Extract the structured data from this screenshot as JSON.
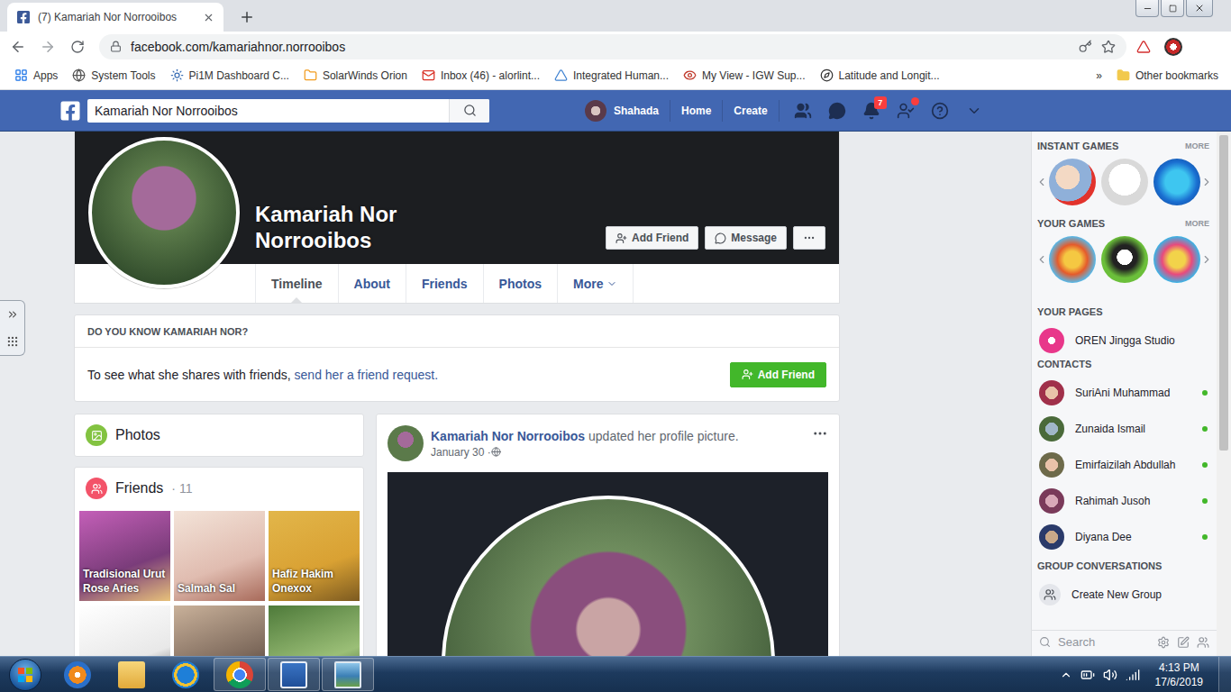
{
  "browser": {
    "tabs": [
      {
        "label": "(7) Kamariah Nor Norrooibos",
        "selected": true
      }
    ],
    "address": "facebook.com/kamariahnor.norrooibos",
    "bookmarks": [
      {
        "label": "Apps",
        "kind": "apps"
      },
      {
        "label": "System Tools",
        "kind": "globe"
      },
      {
        "label": "Pi1M Dashboard C...",
        "kind": "pi"
      },
      {
        "label": "SolarWinds Orion",
        "kind": "solar"
      },
      {
        "label": "Inbox (46) - alorlint...",
        "kind": "gmail"
      },
      {
        "label": "Integrated Human...",
        "kind": "tri"
      },
      {
        "label": "My View - IGW Sup...",
        "kind": "view"
      },
      {
        "label": "Latitude and Longit...",
        "kind": "compass"
      }
    ],
    "overflow": "»",
    "other_bookmarks": "Other bookmarks"
  },
  "header": {
    "search": "Kamariah Nor Norrooibos",
    "user": "Shahada",
    "links": [
      "Home",
      "Create"
    ],
    "notifications": "7",
    "quick_help_alert": true
  },
  "profile": {
    "name": "Kamariah Nor Norrooibos",
    "actions": [
      "Add Friend",
      "Message"
    ],
    "nav": [
      {
        "label": "Timeline",
        "selected": true,
        "dropdown": false
      },
      {
        "label": "About",
        "selected": false,
        "dropdown": false
      },
      {
        "label": "Friends",
        "selected": false,
        "dropdown": false
      },
      {
        "label": "Photos",
        "selected": false,
        "dropdown": false
      },
      {
        "label": "More",
        "selected": false,
        "dropdown": true
      }
    ]
  },
  "know": {
    "title": "DO YOU KNOW KAMARIAH NOR?",
    "text": "To see what she shares with friends, ",
    "link": "send her a friend request.",
    "button": "Add Friend"
  },
  "photos": {
    "title": "Photos"
  },
  "friends": {
    "title": "Friends",
    "count": "· 11",
    "items": [
      {
        "kind": "named",
        "name": "Tradisional Urut Rose Aries"
      },
      {
        "kind": "named",
        "name": "Salmah Sal"
      },
      {
        "kind": "named",
        "name": "Hafiz Hakim Onexox"
      },
      {
        "kind": "cut"
      },
      {
        "kind": "cut"
      },
      {
        "kind": "cut"
      }
    ]
  },
  "post": {
    "author": "Kamariah Nor Norrooibos",
    "action": "updated her profile picture.",
    "date": "January 30 · "
  },
  "sidebar": {
    "instant_games": {
      "title": "INSTANT GAMES",
      "more": "MORE",
      "items": [
        {
          "kind": "uno"
        },
        {
          "kind": "sketch"
        },
        {
          "kind": "tetris"
        }
      ]
    },
    "your_games": {
      "title": "YOUR GAMES",
      "more": "MORE",
      "items": [
        {
          "kind": "fruit"
        },
        {
          "kind": "panda"
        },
        {
          "kind": "candy"
        }
      ]
    },
    "pages": {
      "title": "YOUR PAGES",
      "items": [
        "OREN Jingga Studio"
      ]
    },
    "contacts": {
      "title": "CONTACTS",
      "items": [
        {
          "name": "SuriAni Muhammad",
          "online": true
        },
        {
          "name": "Zunaida Ismail",
          "online": true
        },
        {
          "name": "Emirfaizilah Abdullah",
          "online": true
        },
        {
          "name": "Rahimah Jusoh",
          "online": true
        },
        {
          "name": "Diyana Dee",
          "online": true
        }
      ]
    },
    "groups": {
      "title": "GROUP CONVERSATIONS",
      "create": "Create New Group"
    },
    "search": {
      "placeholder": "Search"
    }
  },
  "taskbar": {
    "apps": [
      {
        "kind": "media",
        "active": false
      },
      {
        "kind": "explorer",
        "active": false
      },
      {
        "kind": "ie",
        "active": false
      },
      {
        "kind": "chrome",
        "active": true
      },
      {
        "kind": "word",
        "active": true
      },
      {
        "kind": "photos",
        "active": true
      }
    ],
    "time": "4:13 PM",
    "date": "17/6/2019"
  }
}
